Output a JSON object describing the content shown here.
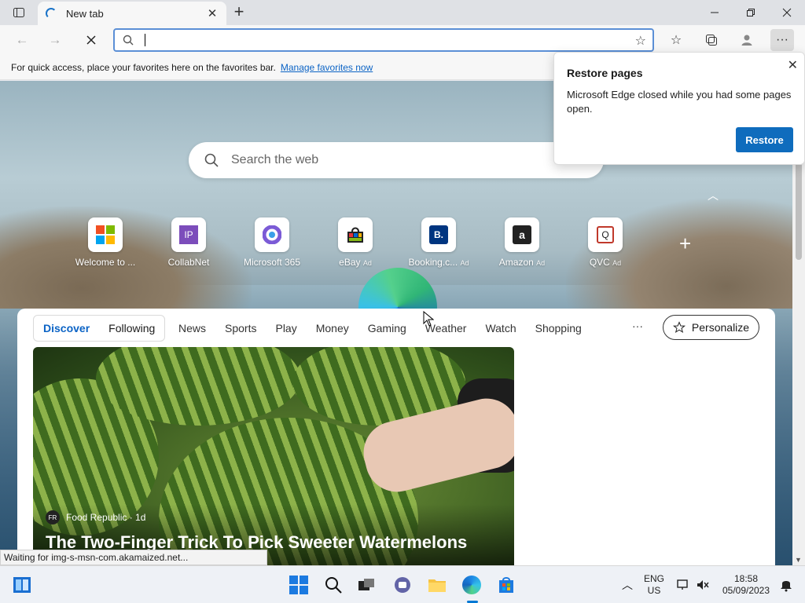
{
  "browser": {
    "tab_title": "New tab",
    "favbar_text": "For quick access, place your favorites here on the favorites bar.",
    "favbar_link": "Manage favorites now"
  },
  "ntp": {
    "search_placeholder": "Search the web",
    "quicklinks": [
      {
        "label": "Welcome to ...",
        "ad": "",
        "icon": "microsoft-logo-icon"
      },
      {
        "label": "CollabNet",
        "ad": "",
        "icon": "collabnet-icon"
      },
      {
        "label": "Microsoft 365",
        "ad": "",
        "icon": "microsoft-365-icon"
      },
      {
        "label": "eBay",
        "ad": "Ad",
        "icon": "ebay-bag-icon"
      },
      {
        "label": "Booking.c...",
        "ad": "Ad",
        "icon": "booking-icon"
      },
      {
        "label": "Amazon",
        "ad": "Ad",
        "icon": "amazon-icon"
      },
      {
        "label": "QVC",
        "ad": "Ad",
        "icon": "qvc-icon"
      }
    ]
  },
  "feed": {
    "tabs": [
      "Discover",
      "Following"
    ],
    "categories": [
      "News",
      "Sports",
      "Play",
      "Money",
      "Gaming",
      "Weather",
      "Watch",
      "Shopping"
    ],
    "more": "···",
    "personalize": "Personalize",
    "article": {
      "source_badge": "FR",
      "source": "Food Republic · 1d",
      "headline": "The Two-Finger Trick To Pick Sweeter Watermelons"
    }
  },
  "status": "Waiting for img-s-msn-com.akamaized.net...",
  "popup": {
    "title": "Restore pages",
    "body": "Microsoft Edge closed while you had some pages open.",
    "button": "Restore"
  },
  "taskbar": {
    "lang_top": "ENG",
    "lang_bottom": "US",
    "time": "18:58",
    "date": "05/09/2023"
  },
  "colors": {
    "accent": "#0f6cbd",
    "link": "#0b63c5"
  }
}
